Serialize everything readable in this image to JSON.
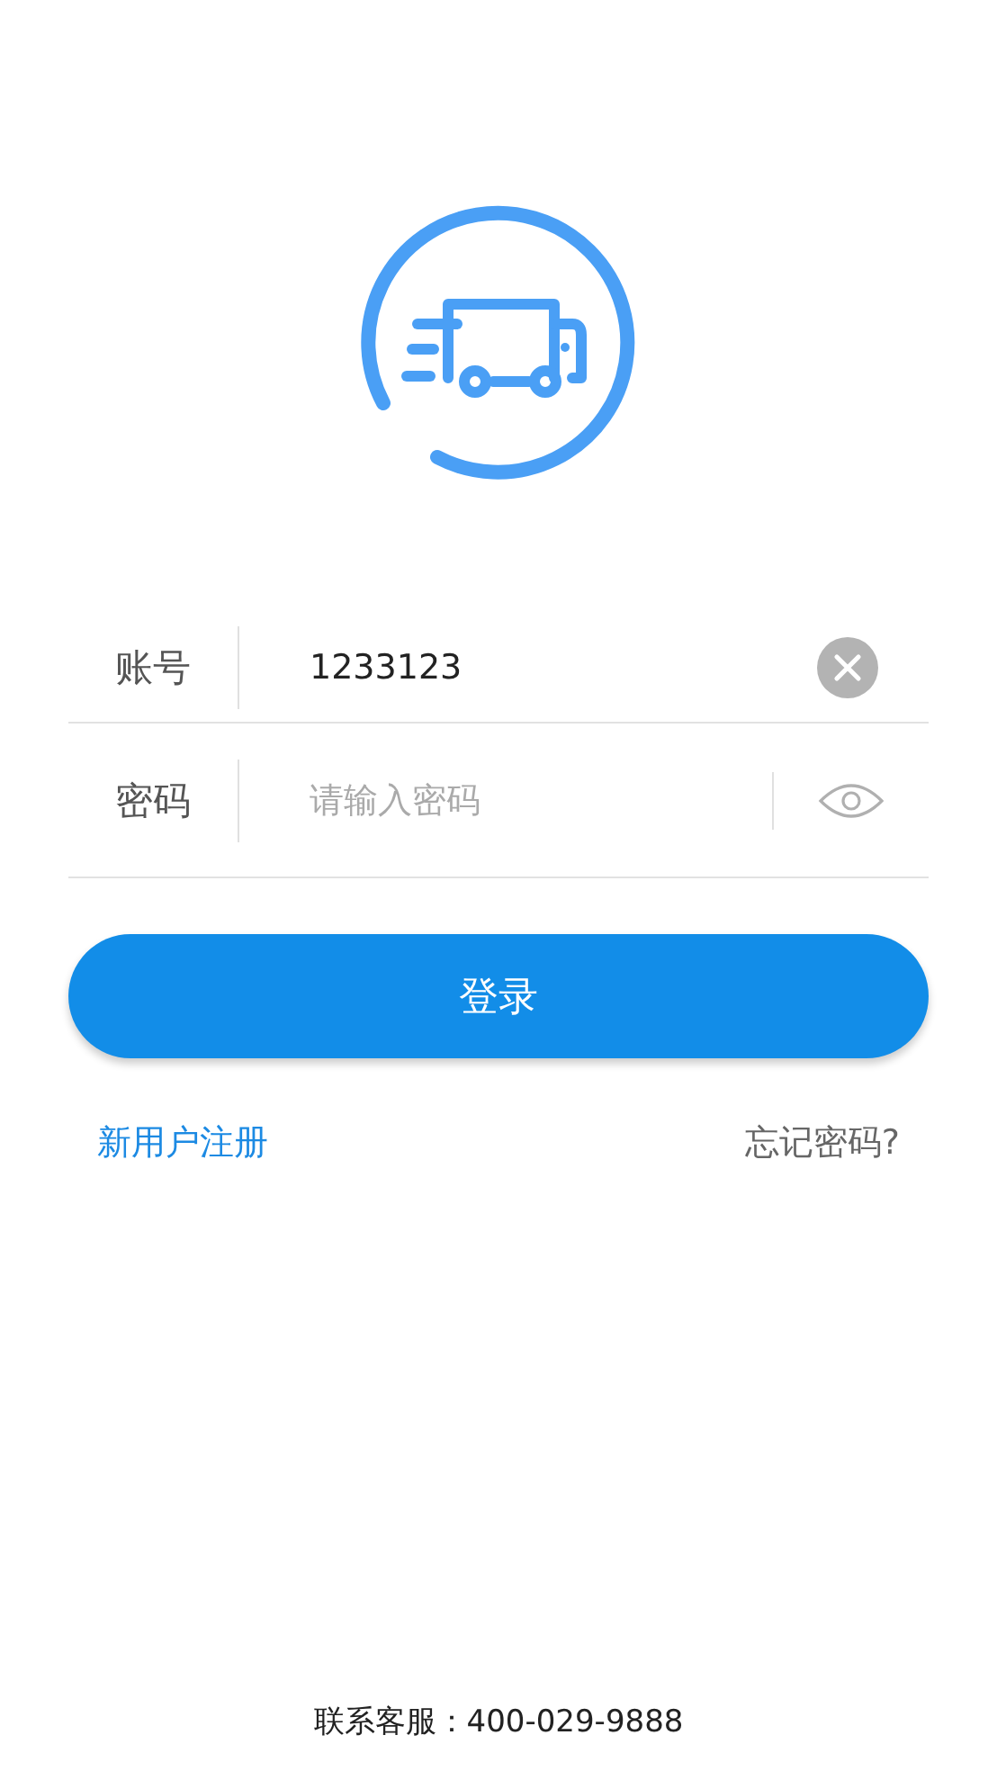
{
  "fields": [
    {
      "kind": "account",
      "label": "账号",
      "value": "1233123"
    },
    {
      "kind": "password",
      "label": "密码",
      "placeholder": "请输入密码"
    }
  ],
  "login_button": "登录",
  "links": {
    "register": "新用户注册",
    "forgot": "忘记密码?"
  },
  "footer": "联系客服：400-029-9888"
}
